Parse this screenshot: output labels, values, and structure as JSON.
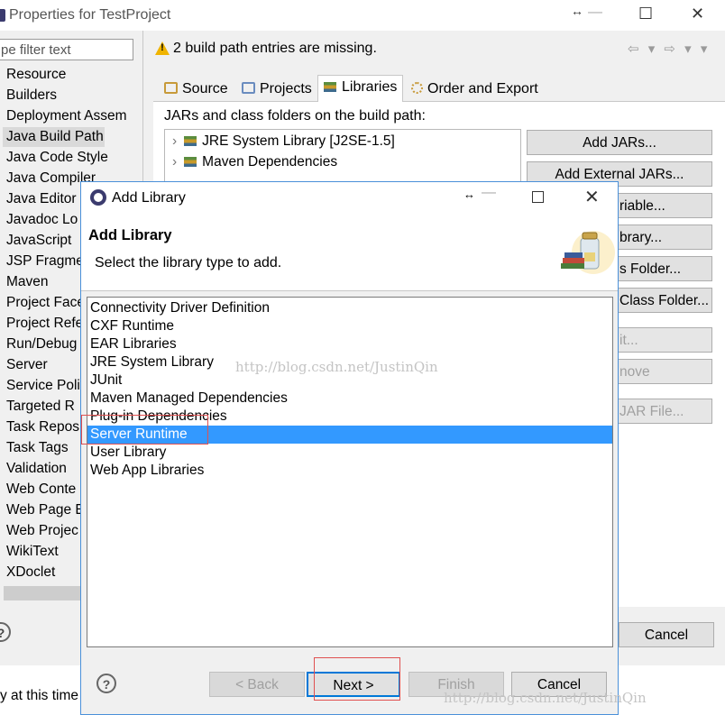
{
  "background_window": {
    "title": "Properties for TestProject",
    "window_controls": {
      "resize": "↔",
      "minimize": "—",
      "maximize": "☐",
      "close": "✕"
    },
    "filter_placeholder": "pe filter text",
    "nav_items": [
      "Resource",
      "Builders",
      "Deployment Assem",
      "Java Build Path",
      "Java Code Style",
      "Java Compiler",
      "Java Editor",
      "Javadoc Lo",
      "JavaScript",
      "JSP Fragme",
      "Maven",
      "Project Face",
      "Project Refe",
      "Run/Debug",
      "Server",
      "Service Poli",
      "Targeted R",
      "Task Repos",
      "Task Tags",
      "Validation",
      "Web Conte",
      "Web Page E",
      "Web Projec",
      "WikiText",
      "XDoclet"
    ],
    "selected_nav": "Java Build Path",
    "warning": "2 build path entries are missing.",
    "nav_arrows": "⇦ ▾ ⇨ ▾ ▾",
    "tabs": [
      {
        "label": "Source",
        "active": false
      },
      {
        "label": "Projects",
        "active": false
      },
      {
        "label": "Libraries",
        "active": true
      },
      {
        "label": "Order and Export",
        "active": false
      }
    ],
    "jars_label": "JARs and class folders on the build path:",
    "tree_items": [
      "JRE System Library [J2SE-1.5]",
      "Maven Dependencies"
    ],
    "side_buttons": {
      "add_jars": "Add JARs...",
      "add_external_jars": "Add External JARs...",
      "add_variable": "riable...",
      "add_library": "brary...",
      "add_class_folder": "s Folder...",
      "add_external_class_folder": "Class Folder...",
      "edit": "it...",
      "remove": "nove",
      "migrate_jar": "JAR File..."
    },
    "help": "?",
    "cancel": "Cancel",
    "bottom_text": "y at this time"
  },
  "dialog": {
    "title": "Add Library",
    "heading": "Add Library",
    "description": "Select the library type to add.",
    "library_types": [
      "Connectivity Driver Definition",
      "CXF Runtime",
      "EAR Libraries",
      "JRE System Library",
      "JUnit",
      "Maven Managed Dependencies",
      "Plug-in Dependencies",
      "Server Runtime",
      "User Library",
      "Web App Libraries"
    ],
    "selected_type": "Server Runtime",
    "watermark": "http://blog.csdn.net/JustinQin",
    "buttons": {
      "back": "< Back",
      "next": "Next >",
      "finish": "Finish",
      "cancel": "Cancel"
    },
    "help": "?"
  },
  "colors": {
    "selection": "#3399ff",
    "highlight_box": "#e05050",
    "default_button_border": "#0078d7",
    "warning": "#f0b400"
  }
}
